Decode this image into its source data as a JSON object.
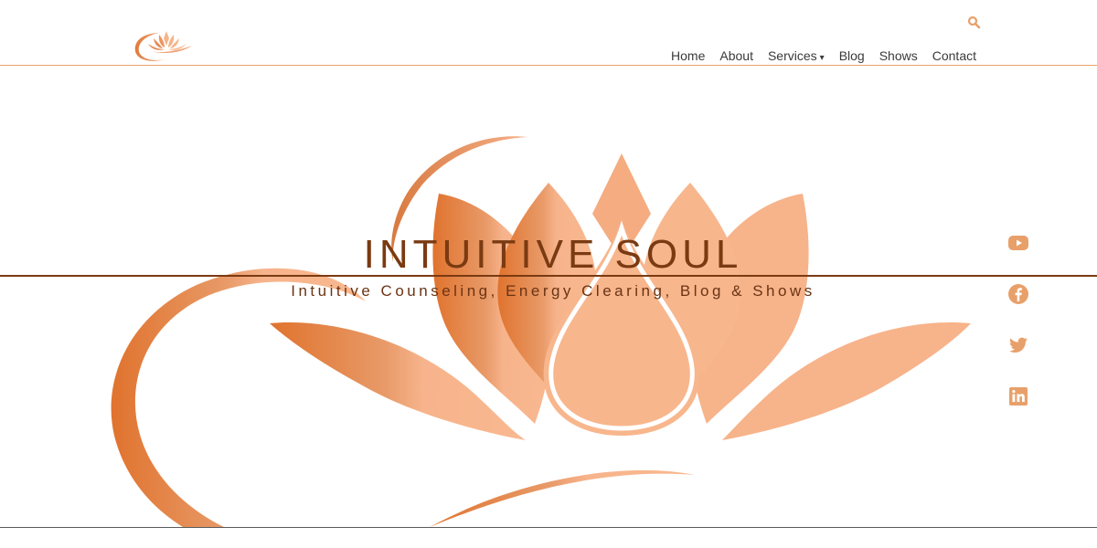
{
  "brand": {
    "accent": "#e8a06a",
    "title_color": "#7a3a12",
    "social_color": "#e8a06a"
  },
  "header": {
    "logo_icon": "lotus-logo-icon",
    "search_icon": "search-icon",
    "nav": [
      {
        "label": "Home"
      },
      {
        "label": "About"
      },
      {
        "label": "Services",
        "has_dropdown": true,
        "caret": "▾"
      },
      {
        "label": "Blog"
      },
      {
        "label": "Shows"
      },
      {
        "label": "Contact"
      }
    ]
  },
  "hero": {
    "title": "INTUITIVE SOUL",
    "subtitle": "Intuitive Counseling, Energy Clearing, Blog & Shows",
    "art_icon": "lotus-illustration"
  },
  "social": [
    {
      "icon": "youtube-icon"
    },
    {
      "icon": "facebook-icon"
    },
    {
      "icon": "twitter-icon"
    },
    {
      "icon": "linkedin-icon"
    }
  ]
}
